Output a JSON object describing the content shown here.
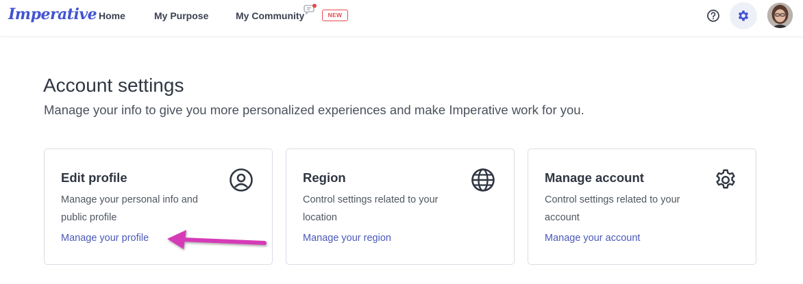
{
  "header": {
    "logo_text": "Imperative",
    "nav": [
      {
        "label": "Home"
      },
      {
        "label": "My Purpose"
      },
      {
        "label": "My Community"
      }
    ],
    "new_badge": "NEW",
    "icons": [
      "chat-icon",
      "help-icon",
      "gear-icon",
      "avatar"
    ]
  },
  "main": {
    "title": "Account settings",
    "subtitle": "Manage your info to give you more personalized experiences and make Imperative work for you.",
    "cards": [
      {
        "title": "Edit profile",
        "description": "Manage your personal info and public profile",
        "link": "Manage your profile",
        "icon": "user-circle-icon"
      },
      {
        "title": "Region",
        "description": "Control settings related to your location",
        "link": "Manage your region",
        "icon": "globe-icon"
      },
      {
        "title": "Manage account",
        "description": "Control settings related to your account",
        "link": "Manage your account",
        "icon": "gear-icon"
      }
    ]
  },
  "colors": {
    "accent": "#4254d1",
    "link": "#4a58b8",
    "badge": "#e5484d",
    "annotation_arrow": "#d63ab7"
  }
}
